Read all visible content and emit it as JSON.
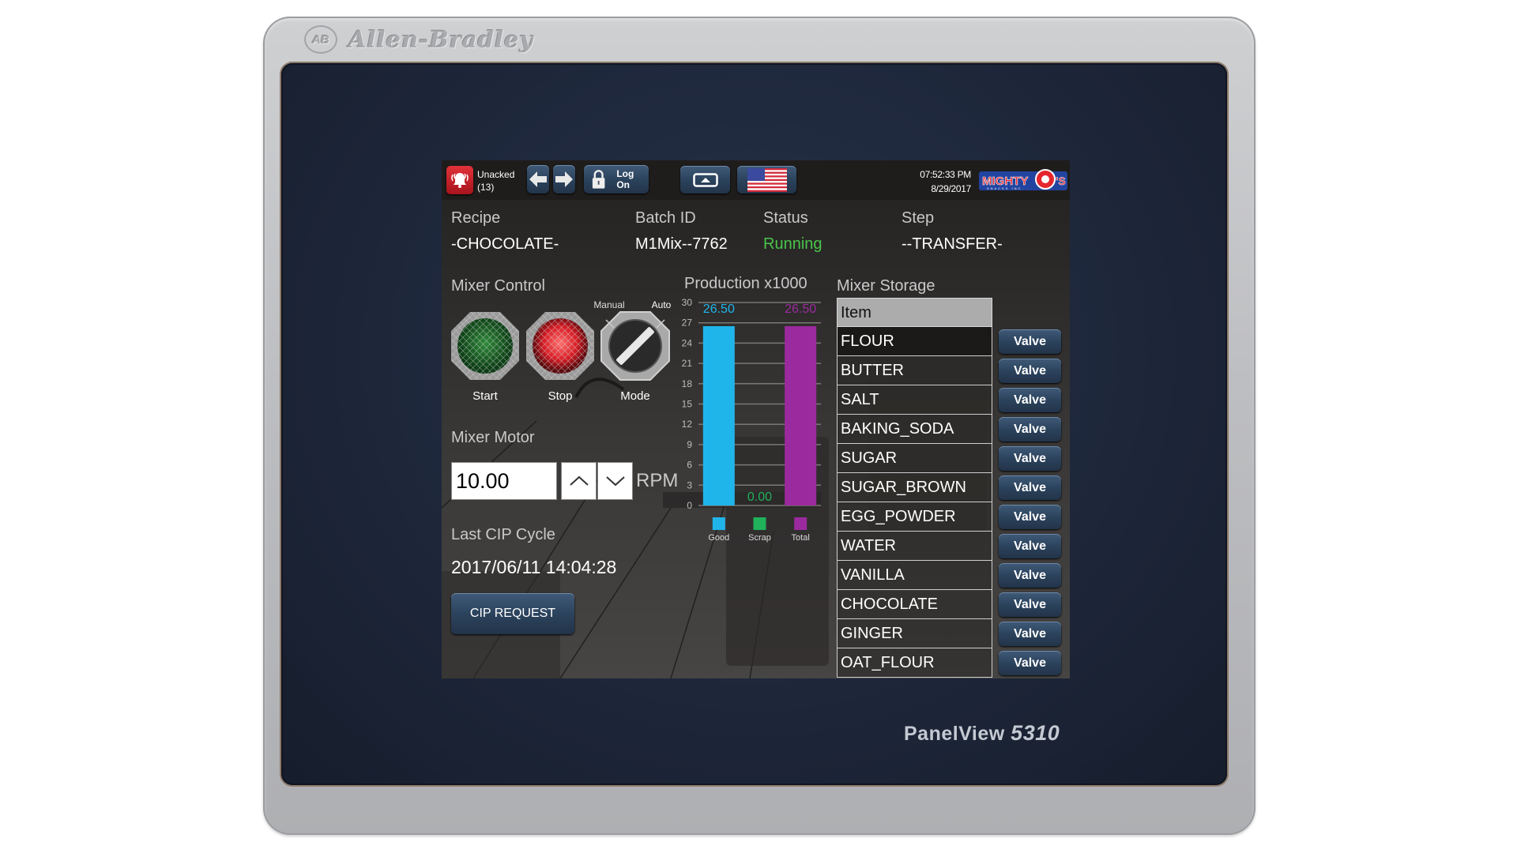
{
  "device": {
    "brand": "Allen-Bradley",
    "brand_badge": "AB",
    "model_prefix": "PanelView",
    "model_number": "5310"
  },
  "topbar": {
    "alarm_icon": "alarm-bell-icon",
    "unacked_label": "Unacked",
    "unacked_count": "(13)",
    "back_icon": "arrow-left-icon",
    "forward_icon": "arrow-right-icon",
    "logon_label": "Log On",
    "logon_icon": "padlock-icon",
    "eject_icon": "eject-icon",
    "language_icon": "us-flag-icon",
    "time": "07:52:33 PM",
    "date": "8/29/2017",
    "logo_text": "MIGHTY Q'S",
    "logo_subtext": "SNACKS INC."
  },
  "header": {
    "recipe_label": "Recipe",
    "recipe_value": "-CHOCOLATE-",
    "batch_label": "Batch ID",
    "batch_value": "M1Mix--7762",
    "status_label": "Status",
    "status_value": "Running",
    "step_label": "Step",
    "step_value": "--TRANSFER-"
  },
  "mixer_control": {
    "title": "Mixer Control",
    "start_label": "Start",
    "stop_label": "Stop",
    "mode_label": "Mode",
    "mode_manual": "Manual",
    "mode_auto": "Auto",
    "mode_selected": "Auto"
  },
  "mixer_motor": {
    "title": "Mixer Motor",
    "value": "10.00",
    "unit": "RPM"
  },
  "cip": {
    "title": "Last CIP Cycle",
    "value": "2017/06/11 14:04:28",
    "button_label": "CIP REQUEST"
  },
  "chart_data": {
    "type": "bar",
    "title": "Production x1000",
    "categories": [
      "Good",
      "Scrap",
      "Total"
    ],
    "values": [
      26.5,
      0.0,
      26.5
    ],
    "value_labels": [
      "26.50",
      "0.00",
      "26.50"
    ],
    "colors": [
      "#1fb5ea",
      "#1fb25a",
      "#9b2a9e"
    ],
    "ylim": [
      0,
      30
    ],
    "yticks": [
      0,
      3,
      6,
      9,
      12,
      15,
      18,
      21,
      24,
      27,
      30
    ],
    "grid": true,
    "legend": "bottom",
    "xlabel": "",
    "ylabel": ""
  },
  "storage": {
    "title": "Mixer Storage",
    "column_header": "Item",
    "valve_label": "Valve",
    "items": [
      "FLOUR",
      "BUTTER",
      "SALT",
      "BAKING_SODA",
      "SUGAR",
      "SUGAR_BROWN",
      "EGG_POWDER",
      "WATER",
      "VANILLA",
      "CHOCOLATE",
      "GINGER",
      "OAT_FLOUR"
    ]
  }
}
